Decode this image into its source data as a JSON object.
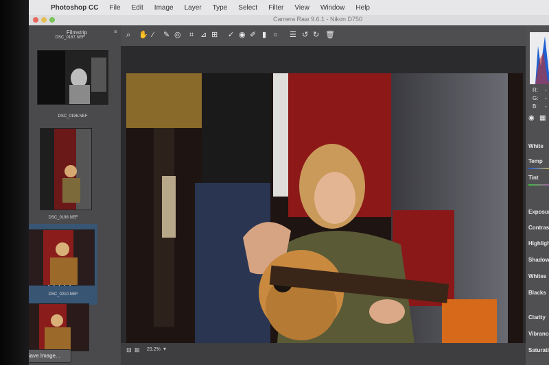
{
  "menubar": {
    "app": "Photoshop CC",
    "items": [
      "File",
      "Edit",
      "Image",
      "Layer",
      "Type",
      "Select",
      "Filter",
      "View",
      "Window",
      "Help"
    ]
  },
  "window": {
    "title": "Camera Raw 9.6.1  -  Nikon D750"
  },
  "filmstrip": {
    "header_label": "Filmstrip",
    "items": [
      {
        "filename": "DSC_0187.NEF"
      },
      {
        "filename": "DSC_0196.NEF"
      },
      {
        "filename": "DSC_0198.NEF"
      },
      {
        "filename": "DSC_0210.NEF"
      }
    ],
    "rating_stars": "• • • • •"
  },
  "buttons": {
    "save_image": "Save Image..."
  },
  "preview": {
    "zoom_level": "29.2%"
  },
  "right_panel": {
    "rgb_labels": [
      "R:",
      "G:",
      "B:"
    ],
    "rgb_values": [
      "-",
      "-",
      "-"
    ],
    "basic_labels": [
      "White",
      "Temp",
      "Tint",
      "Exposure",
      "Contrast",
      "Highlights",
      "Shadows",
      "Whites",
      "Blacks",
      "Clarity",
      "Vibrance",
      "Saturation"
    ]
  },
  "colors": {
    "accent": "#2f5d8f",
    "panel_bg": "#4a4a4c",
    "toolbar_bg": "#4e4e50"
  }
}
